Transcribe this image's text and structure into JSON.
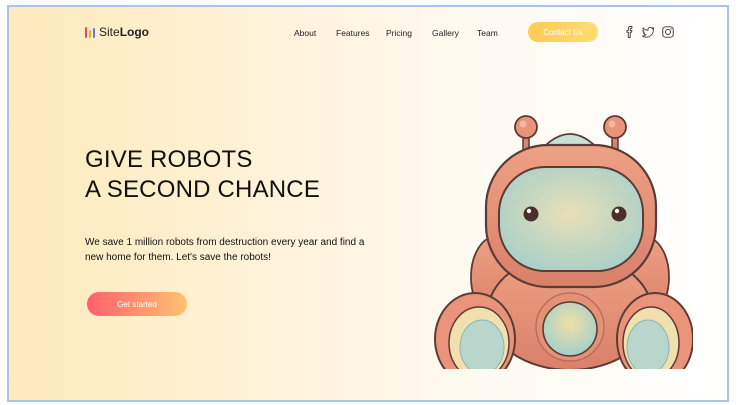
{
  "header": {
    "logo_plain": "Site",
    "logo_bold": "Logo",
    "logo_bar_colors": [
      "#e8445a",
      "#f5a23c",
      "#5a7bd6"
    ],
    "nav": [
      {
        "label": "About"
      },
      {
        "label": "Features"
      },
      {
        "label": "Pricing"
      },
      {
        "label": "Gallery"
      },
      {
        "label": "Team"
      }
    ],
    "contact_label": "Contact Us",
    "social_icons": [
      "facebook-icon",
      "twitter-icon",
      "instagram-icon"
    ]
  },
  "hero": {
    "title_line1": "GIVE ROBOTS",
    "title_line2": "A SECOND CHANCE",
    "description": "We save 1 million robots from destruction every year and find a new home for them. Let's save the robots!",
    "cta_label": "Get started",
    "illustration": "robot-illustration"
  },
  "colors": {
    "contact_gradient": [
      "#ffcb55",
      "#ffdc70"
    ],
    "cta_gradient": [
      "#ff5f6d",
      "#ffc371"
    ],
    "robot_body": "#e49275",
    "robot_visor": "#b7d6c8"
  }
}
